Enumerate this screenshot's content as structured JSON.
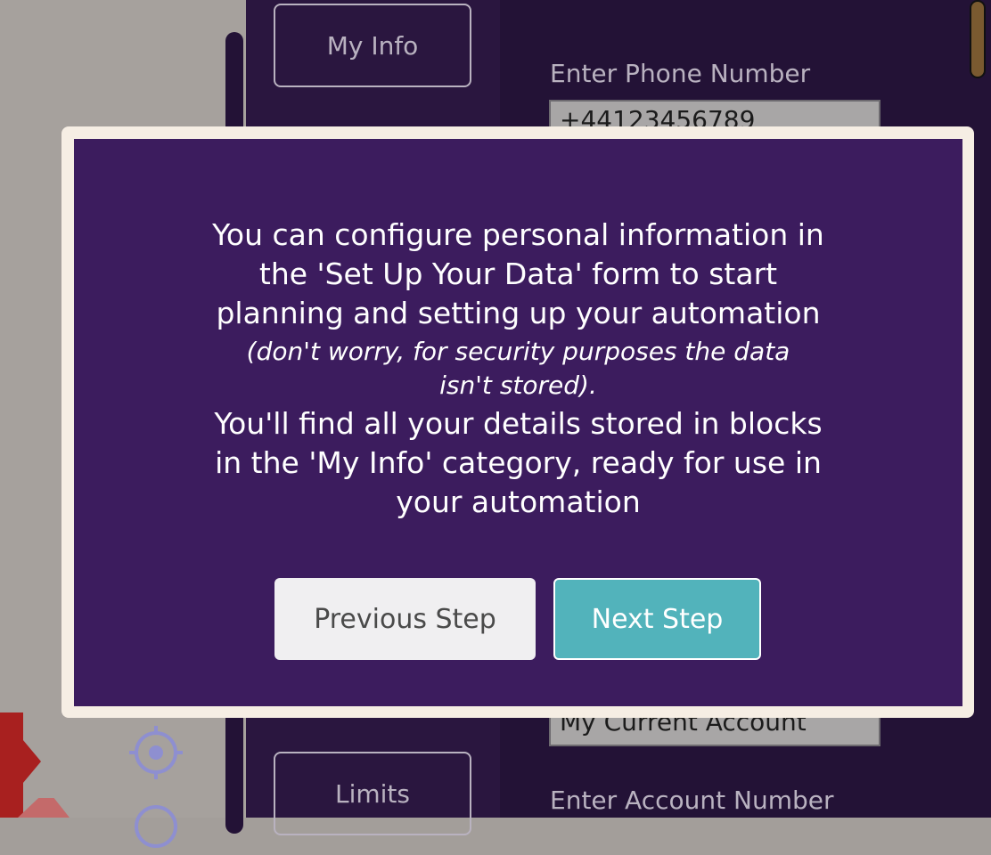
{
  "categories": {
    "my_info": "My Info",
    "limits": "Limits"
  },
  "form": {
    "phone_label": "Enter Phone Number",
    "phone_value": "+44123456789",
    "account_name_value": "My Current Account",
    "account_number_label": "Enter Account Number"
  },
  "modal": {
    "line1": "You can configure personal information in the 'Set Up Your Data' form to start planning and setting up your automation",
    "note": "(don't worry, for security purposes the data isn't stored).",
    "line2": "You'll find all your details stored in blocks in the 'My Info' category, ready for use in your automation",
    "prev_label": "Previous Step",
    "next_label": "Next Step"
  },
  "icons": {
    "target": "crosshair-target-icon"
  },
  "colors": {
    "modal_bg": "#3c1c5e",
    "modal_border": "#f6eee4",
    "next_button": "#52b3bb",
    "panel": "#231236"
  }
}
